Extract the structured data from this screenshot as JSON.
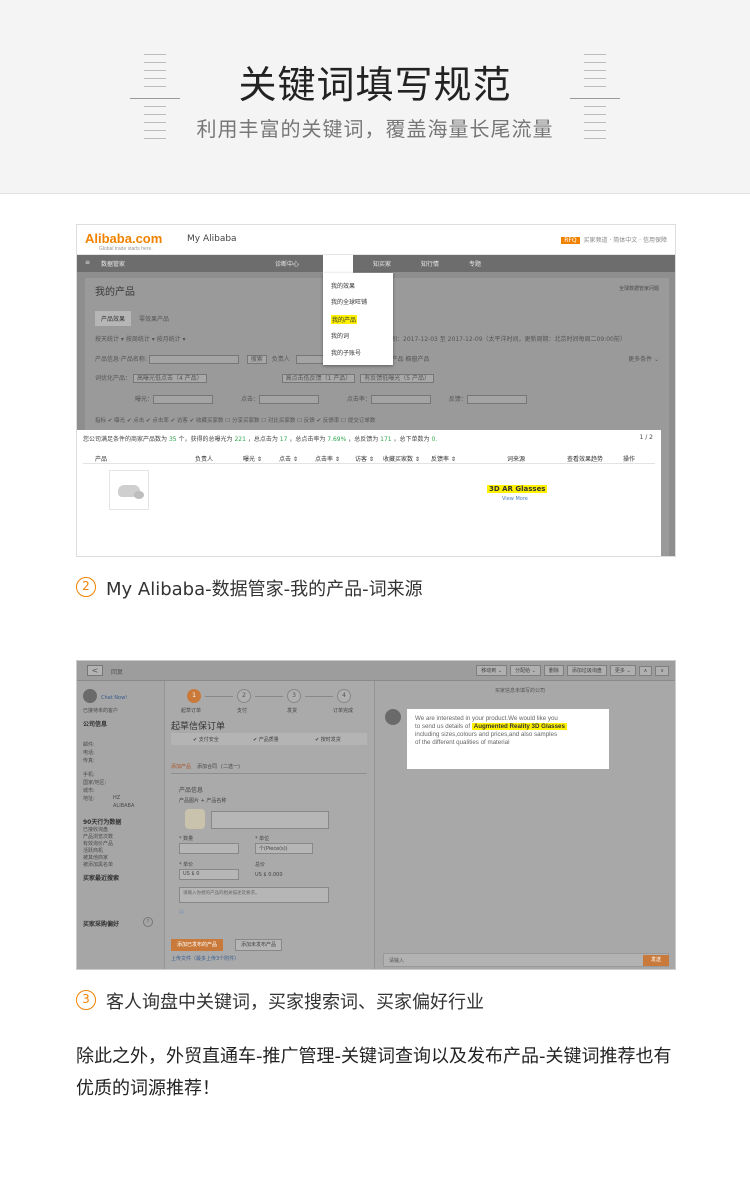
{
  "banner": {
    "title": "关键词填写规范",
    "subtitle": "利用丰富的关键词，覆盖海量长尾流量"
  },
  "shot1": {
    "logo": "Alibaba.com",
    "logo_sub": "Global trade starts here.",
    "my_alibaba": "My Alibaba",
    "top_badge": "RFQ",
    "top_links": "买家频道 · 简体中文 · 信用保障",
    "nav_home": "数据管家",
    "nav_items": [
      "诊断中心",
      "知己",
      "知买家",
      "知行情",
      "专题"
    ],
    "dropdown": [
      "我的效果",
      "我的全球旺铺",
      "我的产品",
      "我的词",
      "我的子账号"
    ],
    "panel_title": "我的产品",
    "tabs": [
      "产品效果",
      "零效果产品"
    ],
    "right_link": "全球数据管家问题",
    "filter_row1": "按天统计 ▾   按周统计 ▾   按月统计 ▾",
    "filter_date": "时间：2017-12-03 至 2017-12-09（太平洋时间，更新周期：北京时间每周二09:00前）",
    "filter_row2_label": "产品信息·产品名称:",
    "filter_row2_placeholder": "请输入产品名称",
    "filter_row2_btn": "搜索",
    "filter_row2_owner": "负责人",
    "filter_row2_checks": "有效果产品   橱窗产品",
    "filter_more": "更多条件 ⌄",
    "filter_row3": "词优化产品：",
    "filter_row3_chips": [
      "高曝光低点击（4 产品）",
      "高点击低反馈（1 产品）",
      "有反馈低曝光（5 产品）"
    ],
    "filter_row4": [
      "曝光：",
      "点击：",
      "点击率：",
      "反馈："
    ],
    "filter_row5": "指标   ✔ 曝光   ✔ 点击   ✔ 点击率   ✔ 访客   ✔ 收藏买家数   ☐ 分享买家数   ☐ 对比买家数   ☐ 反馈   ✔ 反馈率   ☐ 提交订单数",
    "stats_prefix": "您公司满足条件的商家产品数为",
    "stats_count": "35",
    "stats_mid1": "个，获得的总曝光为",
    "stats_exposure": "221",
    "stats_mid2": "，总点击为",
    "stats_clicks": "17",
    "stats_mid3": "，总点击率为",
    "stats_ctr": "7.69%",
    "stats_mid4": "，总反馈为",
    "stats_feedback": "171",
    "stats_mid5": "，总下单数为",
    "stats_orders": "0.",
    "page": "1 / 2",
    "columns": [
      "产品",
      "负责人",
      "曝光 ⇕",
      "点击 ⇕",
      "点击率 ⇕",
      "访客 ⇕",
      "收藏买家数 ⇕",
      "反馈率 ⇕",
      "词来源",
      "查看效果趋势",
      "操作"
    ],
    "keyword": "3D AR Glasses",
    "view_more": "View More"
  },
  "caption1": {
    "num": "2",
    "text": "My Alibaba-数据管家-我的产品-词来源"
  },
  "shot2": {
    "back": "<",
    "reply": "回复",
    "toolbar": [
      "移动到 ⌄",
      "分配给 ⌄",
      "删除",
      "添加垃圾询盘",
      "更多 ⌄",
      "∧",
      "∨"
    ],
    "left": {
      "chat": "Chat Now!",
      "status": "已接待未的客户",
      "company_title": "公司信息",
      "info": [
        "邮件:",
        "电话:",
        "传真:",
        "手机:",
        "国家/地区:",
        "城市:",
        "地址:",
        "HZ",
        "ALIBABA"
      ],
      "behavior_title": "90天行为数据",
      "behavior": [
        "已接收询盘",
        "产品浏览次数",
        "有效询价产品",
        "活跃商机",
        "被其他商家",
        "被添加黑名单"
      ],
      "search_title": "买家最近搜索",
      "pref_title": "买家采购偏好"
    },
    "steps": [
      "1",
      "2",
      "3",
      "4"
    ],
    "step_labels": [
      "起草订单",
      "支付",
      "发货",
      "订单完成"
    ],
    "order_title": "起草信保订单",
    "order_tags": [
      "✔ 支付安全",
      "✔ 产品质量",
      "✔ 按时发货"
    ],
    "add_tabs": [
      "添加产品",
      "添加合同",
      "(二选一)"
    ],
    "product_info": "产品信息",
    "product_sub": "产品图片  + 产品名称",
    "qty_label": "* 数量",
    "unit_label": "* 单位",
    "unit_value": "个(Piece(s))",
    "price_label": "* 单价",
    "total_label": "总价",
    "price_value": "US $  0",
    "total_value": "US $ 0.000",
    "desc_placeholder": "请输入你想的产品的相关描述及要求。",
    "btn_add_published": "添加已发布的产品",
    "btn_add_unpublished": "添加未发布产品",
    "upload_note": "上传文件（最多上传3个附件）",
    "company": "买家信息未填写的公司",
    "msg_line1": "We are interested in your product.We would like you",
    "msg_line2a": "to send us details of",
    "msg_keyword": "Augmented Reality 3D Glasses",
    "msg_line3": "including sizes,colours and prices,and also samples",
    "msg_line4": "of the different qualities of material",
    "input_placeholder": "请输入",
    "send": "发送"
  },
  "caption2": {
    "num": "3",
    "text": "客人询盘中关键词，买家搜索词、买家偏好行业"
  },
  "paragraph": "除此之外，外贸直通车-推广管理-关键词查询以及发布产品-关键词推荐也有优质的词源推荐！",
  "colors": {
    "accent": "#f08200",
    "highlight": "#fff200",
    "banner_bg": "#f4f4f4"
  }
}
